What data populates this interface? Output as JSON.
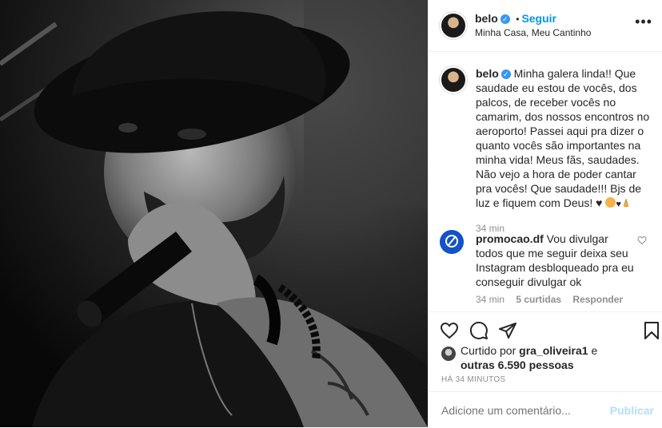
{
  "post": {
    "username": "belo",
    "verified_mark": "✓",
    "dot": "•",
    "follow_label": "Seguir",
    "location": "Minha Casa, Meu Cantinho",
    "more_icon": "more-horizontal-icon"
  },
  "caption": {
    "username": "belo",
    "text": "Minha galera linda!! Que saudade eu estou de vocês, dos palcos, de receber vocês no camarim, dos nossos encontros no aeroporto! Passei aqui pra dizer o quanto vocês são importantes na minha vida! Meus fãs, saudades. Não vejo a hora de poder cantar pra vocês! Que saudade!!! Bjs de luz e fiquem com Deus! ♥",
    "time": "34 min"
  },
  "comment": {
    "username": "promocao.df",
    "text": "Vou divulgar todos que me seguir deixa seu Instagram desbloqueado pra eu conseguir divulgar ok",
    "time": "34 min",
    "likes": "5 curtidas",
    "reply_label": "Responder"
  },
  "likes": {
    "prefix": "Curtido por",
    "user": "gra_oliveira1",
    "and": "e",
    "others": "outras 6.590 pessoas"
  },
  "timestamp": "HÁ 34 MINUTOS",
  "add_comment": {
    "placeholder": "Adicione um comentário...",
    "post_label": "Publicar"
  },
  "colors": {
    "link": "#0095f6",
    "verified": "#3897f0",
    "muted": "#8e8e8e",
    "border": "#efefef"
  }
}
